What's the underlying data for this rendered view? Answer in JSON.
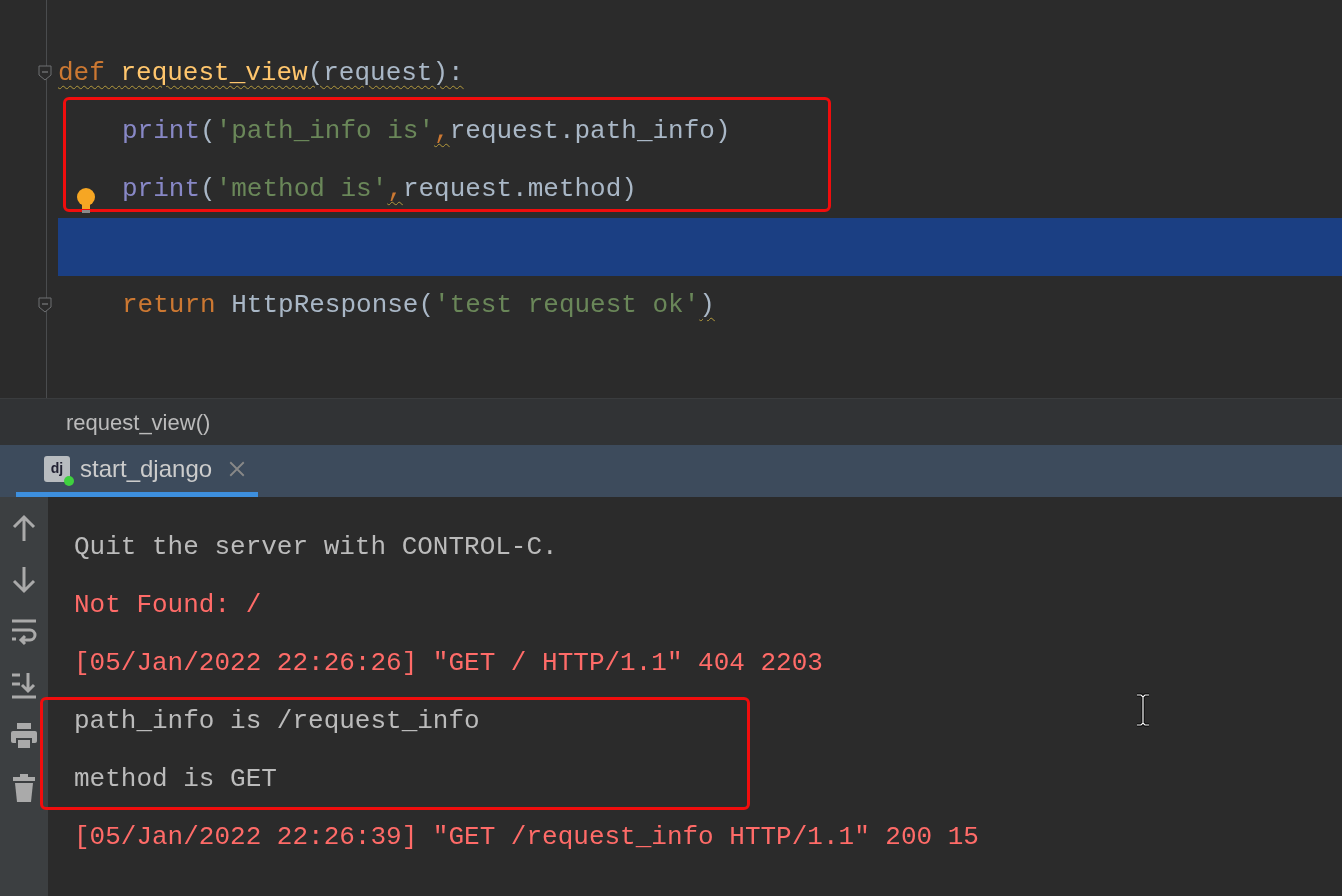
{
  "editor": {
    "lines": [
      {
        "indented": false,
        "fold_marker": true,
        "current": false,
        "bulb": false,
        "boxed": false,
        "tokens": [
          {
            "text": "def ",
            "kind": "keyword",
            "warn": true
          },
          {
            "text": "request_view",
            "kind": "function",
            "warn": true
          },
          {
            "text": "(request):",
            "kind": "plain",
            "warn": true
          }
        ]
      },
      {
        "indented": true,
        "fold_marker": false,
        "current": false,
        "bulb": false,
        "boxed": true,
        "tokens": [
          {
            "text": "print",
            "kind": "builtin",
            "warn": false
          },
          {
            "text": "(",
            "kind": "plain",
            "warn": false
          },
          {
            "text": "'path_info is'",
            "kind": "string",
            "warn": false
          },
          {
            "text": ",",
            "kind": "keyword",
            "warn": true
          },
          {
            "text": "request.path_info)",
            "kind": "plain",
            "warn": false
          }
        ]
      },
      {
        "indented": true,
        "fold_marker": false,
        "current": false,
        "bulb": true,
        "boxed": true,
        "tokens": [
          {
            "text": "print",
            "kind": "builtin",
            "warn": false
          },
          {
            "text": "(",
            "kind": "plain",
            "warn": false
          },
          {
            "text": "'method is'",
            "kind": "string",
            "warn": false
          },
          {
            "text": ",",
            "kind": "keyword",
            "warn": true
          },
          {
            "text": "request.method)",
            "kind": "plain",
            "warn": false
          }
        ]
      },
      {
        "indented": false,
        "fold_marker": false,
        "current": true,
        "bulb": false,
        "boxed": false
      },
      {
        "indented": true,
        "fold_marker": true,
        "current": false,
        "bulb": false,
        "boxed": false,
        "tokens": [
          {
            "text": "return",
            "kind": "keyword",
            "warn": false
          },
          {
            "text": " HttpResponse(",
            "kind": "plain",
            "warn": false
          },
          {
            "text": "'test request ok'",
            "kind": "string",
            "warn": false
          },
          {
            "text": ")",
            "kind": "plain",
            "warn": true
          }
        ]
      }
    ]
  },
  "breadcrumb": "request_view()",
  "run_tabs": [
    {
      "label": "start_django",
      "icon_text": "dj",
      "selected": true
    }
  ],
  "console": {
    "lines": [
      {
        "text": "Quit the server with CONTROL-C.",
        "kind": "info",
        "boxed": false
      },
      {
        "text": "Not Found: /",
        "kind": "error",
        "boxed": false
      },
      {
        "text": "[05/Jan/2022 22:26:26] \"GET / HTTP/1.1\" 404 2203",
        "kind": "error",
        "boxed": false
      },
      {
        "text": "path_info is /request_info",
        "kind": "info",
        "boxed": true
      },
      {
        "text": "method is GET",
        "kind": "info",
        "boxed": true
      },
      {
        "text": "[05/Jan/2022 22:26:39] \"GET /request_info HTTP/1.1\" 200 15",
        "kind": "error",
        "boxed": false
      }
    ]
  }
}
